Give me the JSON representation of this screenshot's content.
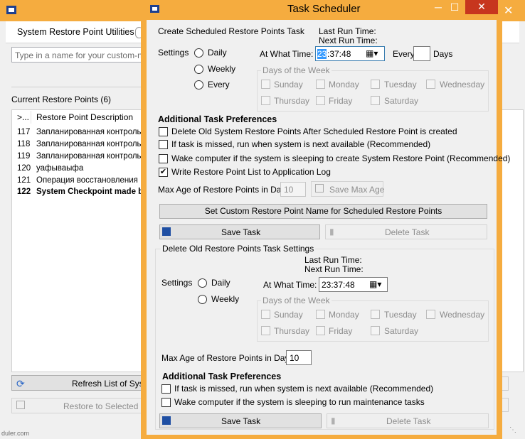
{
  "background_window": {
    "app_title": "System Restore Point Utilities",
    "search_placeholder": "Type in a name for your custom-named",
    "list_title": "Current Restore Points (6)",
    "list_columns": [
      ">...",
      "Restore Point Description"
    ],
    "rows": [
      {
        "id": "117",
        "desc": "Запланированная контрольна"
      },
      {
        "id": "118",
        "desc": "Запланированная контрольна"
      },
      {
        "id": "119",
        "desc": "Запланированная контрольна"
      },
      {
        "id": "120",
        "desc": "уафываыфа"
      },
      {
        "id": "121",
        "desc": "Операция восстановления"
      },
      {
        "id": "122",
        "desc": "System Checkpoint made b"
      }
    ],
    "refresh_button": "Refresh List of Syster",
    "restore_button": "Restore to Selected Sy",
    "statusbar_text": "duler.com"
  },
  "dialog": {
    "title": "Task Scheduler",
    "create_section": {
      "title": "Create Scheduled Restore Points Task",
      "last_run_label": "Last Run Time:",
      "next_run_label": "Next Run Time:",
      "settings_label": "Settings",
      "radios": [
        "Daily",
        "Weekly",
        "Every"
      ],
      "time_label": "At What Time:",
      "time_value_hl": "23",
      "time_value_rest": ":37:48",
      "every_label": "Every",
      "every_value": "",
      "days_label": "Days",
      "days_group_title": "Days of the Week",
      "days": [
        "Sunday",
        "Monday",
        "Tuesday",
        "Wednesday",
        "Thursday",
        "Friday",
        "Saturday"
      ],
      "prefs_title": "Additional Task Preferences",
      "prefs": [
        {
          "label": "Delete Old System Restore Points After Scheduled Restore Point is created",
          "checked": false
        },
        {
          "label": "If task is missed, run when system is next available (Recommended)",
          "checked": false
        },
        {
          "label": "Wake computer if the system is sleeping to create System Restore Point (Recommended)",
          "checked": false
        },
        {
          "label": "Write Restore Point List to Application Log",
          "checked": true
        }
      ],
      "max_age_label": "Max Age of Restore Points in Days:",
      "max_age_value": "10",
      "save_max_age_button": "Save Max Age",
      "custom_name_button": "Set Custom Restore Point Name for Scheduled Restore Points",
      "save_task_button": "Save Task",
      "delete_task_button": "Delete Task"
    },
    "delete_section": {
      "title": "Delete Old Restore Points Task Settings",
      "last_run_label": "Last Run Time:",
      "next_run_label": "Next Run Time:",
      "settings_label": "Settings",
      "radios": [
        "Daily",
        "Weekly"
      ],
      "time_label": "At What Time:",
      "time_value": "23:37:48",
      "days_group_title": "Days of the Week",
      "days": [
        "Sunday",
        "Monday",
        "Tuesday",
        "Wednesday",
        "Thursday",
        "Friday",
        "Saturday"
      ],
      "max_age_label": "Max Age of Restore Points in Days:",
      "max_age_value": "10",
      "prefs_title": "Additional Task Preferences",
      "prefs": [
        {
          "label": "If task is missed, run when system is next available (Recommended)",
          "checked": false
        },
        {
          "label": "Wake computer if the system is sleeping to run maintenance tasks",
          "checked": false
        }
      ],
      "save_task_button": "Save Task",
      "delete_task_button": "Delete Task"
    }
  }
}
